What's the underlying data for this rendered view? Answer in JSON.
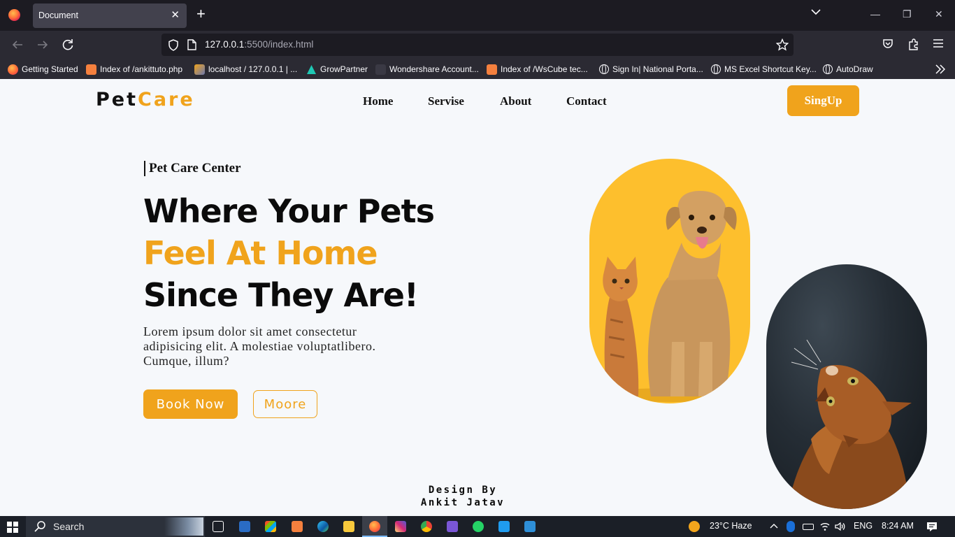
{
  "browser": {
    "tab_title": "Document",
    "url_host": "127.0.0.1",
    "url_rest": ":5500/index.html",
    "bookmarks": [
      "Getting Started",
      "Index of /ankittuto.php",
      "localhost / 127.0.0.1 | ...",
      "GrowPartner",
      "Wondershare Account...",
      "Index of /WsCube tec...",
      "Sign In| National Porta...",
      "MS Excel Shortcut Key...",
      "AutoDraw"
    ]
  },
  "site": {
    "logo_prefix": "Pet",
    "logo_suffix": "Care",
    "nav": [
      "Home",
      "Servise",
      "About",
      "Contact"
    ],
    "signup_label": "SingUp",
    "tagline": "Pet Care Center",
    "headline_1": "Where Your Pets",
    "headline_2": "Feel At Home",
    "headline_3": "Since They Are!",
    "description": "Lorem ipsum dolor sit amet consectetur adipisicing elit. A molestiae voluptatlibero. Cumque, illum?",
    "book_label": "Book Now",
    "more_label": "Moore",
    "credit_1": "Design By",
    "credit_2": "Ankit Jatav",
    "colors": {
      "accent": "#f0a31c",
      "dog_card": "#fdbf2d",
      "page_bg": "#f6f8fb"
    }
  },
  "taskbar": {
    "search_label": "Search",
    "weather": "23°C  Haze",
    "language": "ENG",
    "time": "8:24 AM"
  }
}
